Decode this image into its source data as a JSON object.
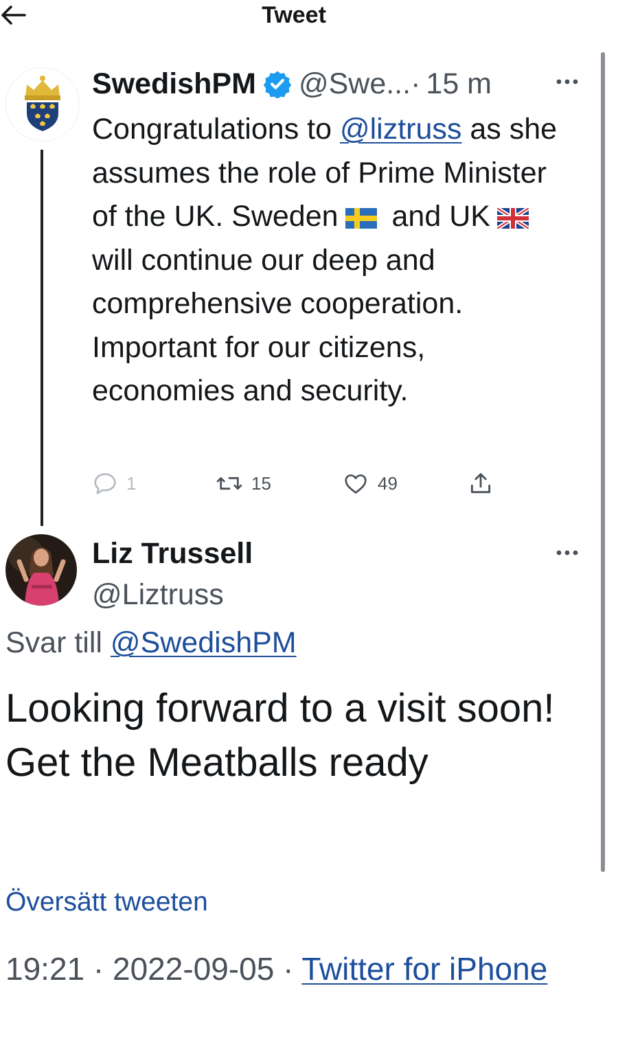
{
  "header": {
    "title": "Tweet"
  },
  "parent_tweet": {
    "name": "SwedishPM",
    "handle": "@Swe...",
    "separator": "·",
    "time": "15 m",
    "text_before": "Congratulations to ",
    "mention": "@liztruss",
    "text_part2": " as she assumes the role of Prime Minister of the UK. Sweden",
    "text_part3": " and UK",
    "text_part4": " will continue our deep and comprehensive cooperation. Important for our citizens, economies and security.",
    "stats": {
      "replies": "1",
      "retweets": "15",
      "likes": "49"
    }
  },
  "reply_tweet": {
    "name": "Liz Trussell",
    "handle": "@Liztruss",
    "reply_prefix": "Svar till ",
    "reply_to": "@SwedishPM",
    "text": "Looking forward to a visit soon! Get the Meatballs ready",
    "translate": "Översätt tweeten",
    "timestamp": "19:21 · 2022-09-05 · ",
    "source": "Twitter for iPhone"
  },
  "colors": {
    "link": "#1d4e9c",
    "verified": "#1d9bf0",
    "muted": "#4a5159",
    "text": "#14171a"
  },
  "icons": [
    "back-arrow-icon",
    "verified-badge-icon",
    "more-icon",
    "reply-icon",
    "retweet-icon",
    "like-icon",
    "share-icon",
    "sweden-flag-icon",
    "uk-flag-icon"
  ]
}
